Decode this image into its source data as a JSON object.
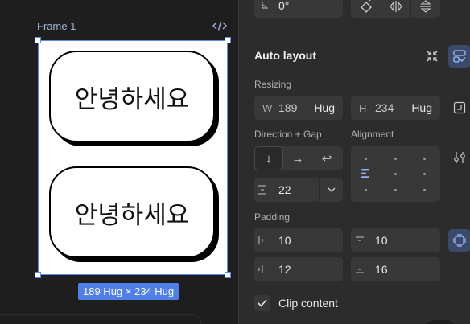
{
  "canvas": {
    "frame_label": "Frame 1",
    "pill_text_1": "안녕하세요",
    "pill_text_2": "안녕하세요",
    "size_badge": "189 Hug × 234 Hug"
  },
  "panel": {
    "rotation": {
      "icon": "angle-icon",
      "value": "0°"
    },
    "auto_layout": {
      "title": "Auto layout"
    },
    "resizing": {
      "label": "Resizing",
      "width": {
        "prefix": "W",
        "value": "189",
        "mode": "Hug"
      },
      "height": {
        "prefix": "H",
        "value": "234",
        "mode": "Hug"
      }
    },
    "direction": {
      "label": "Direction + Gap",
      "options": [
        "↓",
        "→",
        "↩"
      ],
      "selected": 0,
      "gap_value": "22"
    },
    "alignment": {
      "label": "Alignment",
      "selected": "top-left"
    },
    "padding": {
      "label": "Padding",
      "left": "10",
      "top": "10",
      "right": "12",
      "bottom": "16"
    },
    "clip_content": {
      "label": "Clip content",
      "checked": true
    }
  },
  "colors": {
    "accent": "#5b8def",
    "panel_bg": "#2c2c2c",
    "field_bg": "#383838",
    "canvas_bg": "#1e1e1e"
  }
}
